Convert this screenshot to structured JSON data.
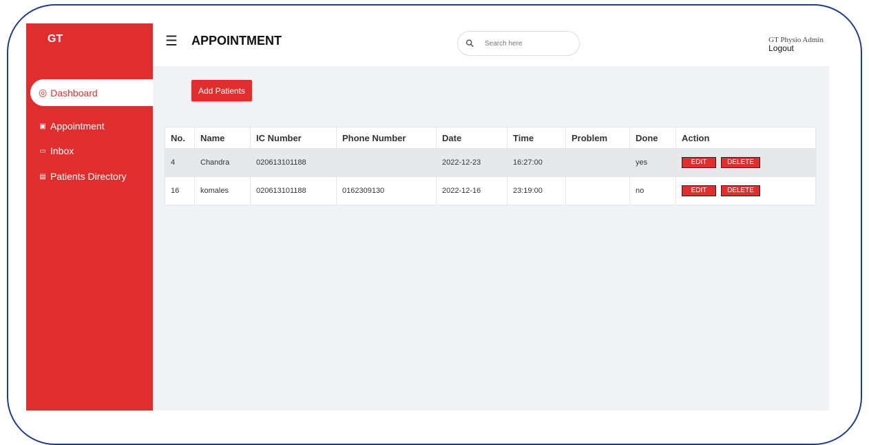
{
  "sidebar": {
    "logo": "GT",
    "items": [
      {
        "label": "Dashboard",
        "icon": "dashboard-icon"
      },
      {
        "label": "Appointment",
        "icon": "calendar-icon"
      },
      {
        "label": "Inbox",
        "icon": "chat-icon"
      },
      {
        "label": "Patients Directory",
        "icon": "directory-icon"
      }
    ]
  },
  "header": {
    "title": "APPOINTMENT",
    "search_placeholder": "Search here",
    "user_name": "GT Physio Admin",
    "logout_label": "Logout"
  },
  "main": {
    "add_button_label": "Add Patients",
    "table": {
      "columns": [
        "No.",
        "Name",
        "IC Number",
        "Phone Number",
        "Date",
        "Time",
        "Problem",
        "Done",
        "Action"
      ],
      "rows": [
        {
          "no": "4",
          "name": "Chandra",
          "ic": "020613101188",
          "phone": "",
          "date": "2022-12-23",
          "time": "16:27:00",
          "problem": "",
          "done": "yes"
        },
        {
          "no": "16",
          "name": "komales",
          "ic": "020613101188",
          "phone": "0162309130",
          "date": "2022-12-16",
          "time": "23:19:00",
          "problem": "",
          "done": "no"
        }
      ],
      "edit_label": "EDIT",
      "delete_label": "DELETE"
    }
  },
  "colors": {
    "accent": "#e02e2e",
    "background": "#f1f2f5",
    "frame": "#1f3c88"
  }
}
